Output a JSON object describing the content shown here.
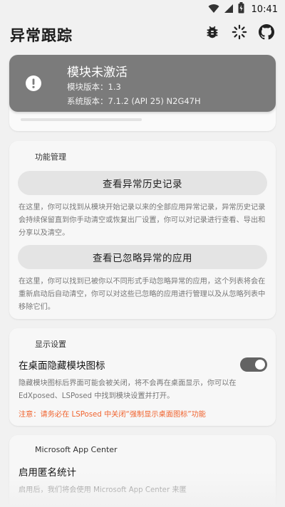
{
  "status_bar": {
    "time": "10:41"
  },
  "app_bar": {
    "title": "异常跟踪"
  },
  "status_card": {
    "title": "模块未激活",
    "module_version": "模块版本：1.3",
    "system_version": "系统版本：7.1.2 (API 25) N2G47H"
  },
  "feature_management": {
    "title": "功能管理",
    "history_button": "查看异常历史记录",
    "history_desc": "在这里，你可以找到从模块开始记录以来的全部应用异常记录，异常历史记录会持续保留直到你手动清空或恢复出厂设置，你可以对记录进行查看、导出和分享以及清空。",
    "ignored_button": "查看已忽略异常的应用",
    "ignored_desc": "在这里，你可以找到已被你以不同形式手动忽略异常的应用，这个列表将会在重新启动后自动清空，你可以对这些已忽略的应用进行管理以及从忽略列表中移除它们。"
  },
  "display_settings": {
    "title": "显示设置",
    "hide_icon_label": "在桌面隐藏模块图标",
    "hide_icon_enabled": true,
    "hide_icon_desc": "隐藏模块图标后界面可能会被关闭，将不会再在桌面显示，你可以在 EdXposed、LSPosed 中找到模块设置并打开。",
    "warning": "注意：请务必在 LSPosed 中关闭“强制显示桌面图标”功能"
  },
  "app_center": {
    "title": "Microsoft App Center",
    "anon_stats_label": "启用匿名统计",
    "anon_stats_desc": "启用后，我们将会使用 Microsoft App Center 来匿"
  },
  "icons": {
    "status_bar": [
      "wifi-icon",
      "signal-icon",
      "battery-icon"
    ],
    "app_bar": [
      "bug-icon",
      "loading-icon",
      "github-icon"
    ],
    "status_card": "alert-icon"
  },
  "colors": {
    "status_card_bg": "#7b7b7b",
    "switch_on": "#636363",
    "warning_text": "#f0632e"
  }
}
